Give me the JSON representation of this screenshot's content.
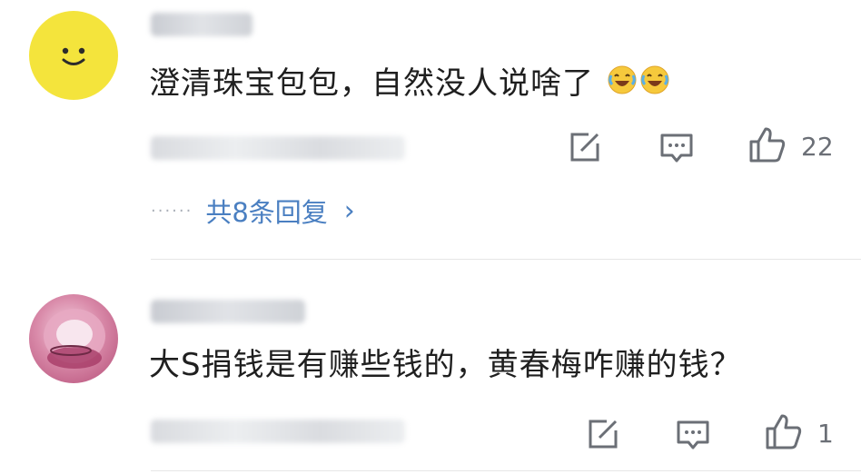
{
  "comments": [
    {
      "text": "澄清珠宝包包，自然没人说啥了",
      "emoji": [
        "laughing-crying-emoji",
        "laughing-crying-emoji"
      ],
      "likes": "22",
      "replies": {
        "label": "共8条回复",
        "chevron": "›"
      }
    },
    {
      "text": "大S捐钱是有赚些钱的，黄春梅咋赚的钱？",
      "likes": "1"
    }
  ],
  "icons": [
    "share-icon",
    "comment-icon",
    "thumb-up-icon",
    "chevron-right-icon",
    "smile-avatar-icon"
  ],
  "colors": {
    "link_blue": "#4a7fc1",
    "icon_gray": "#6b6f76",
    "avatar_yellow": "#f4e43c"
  }
}
